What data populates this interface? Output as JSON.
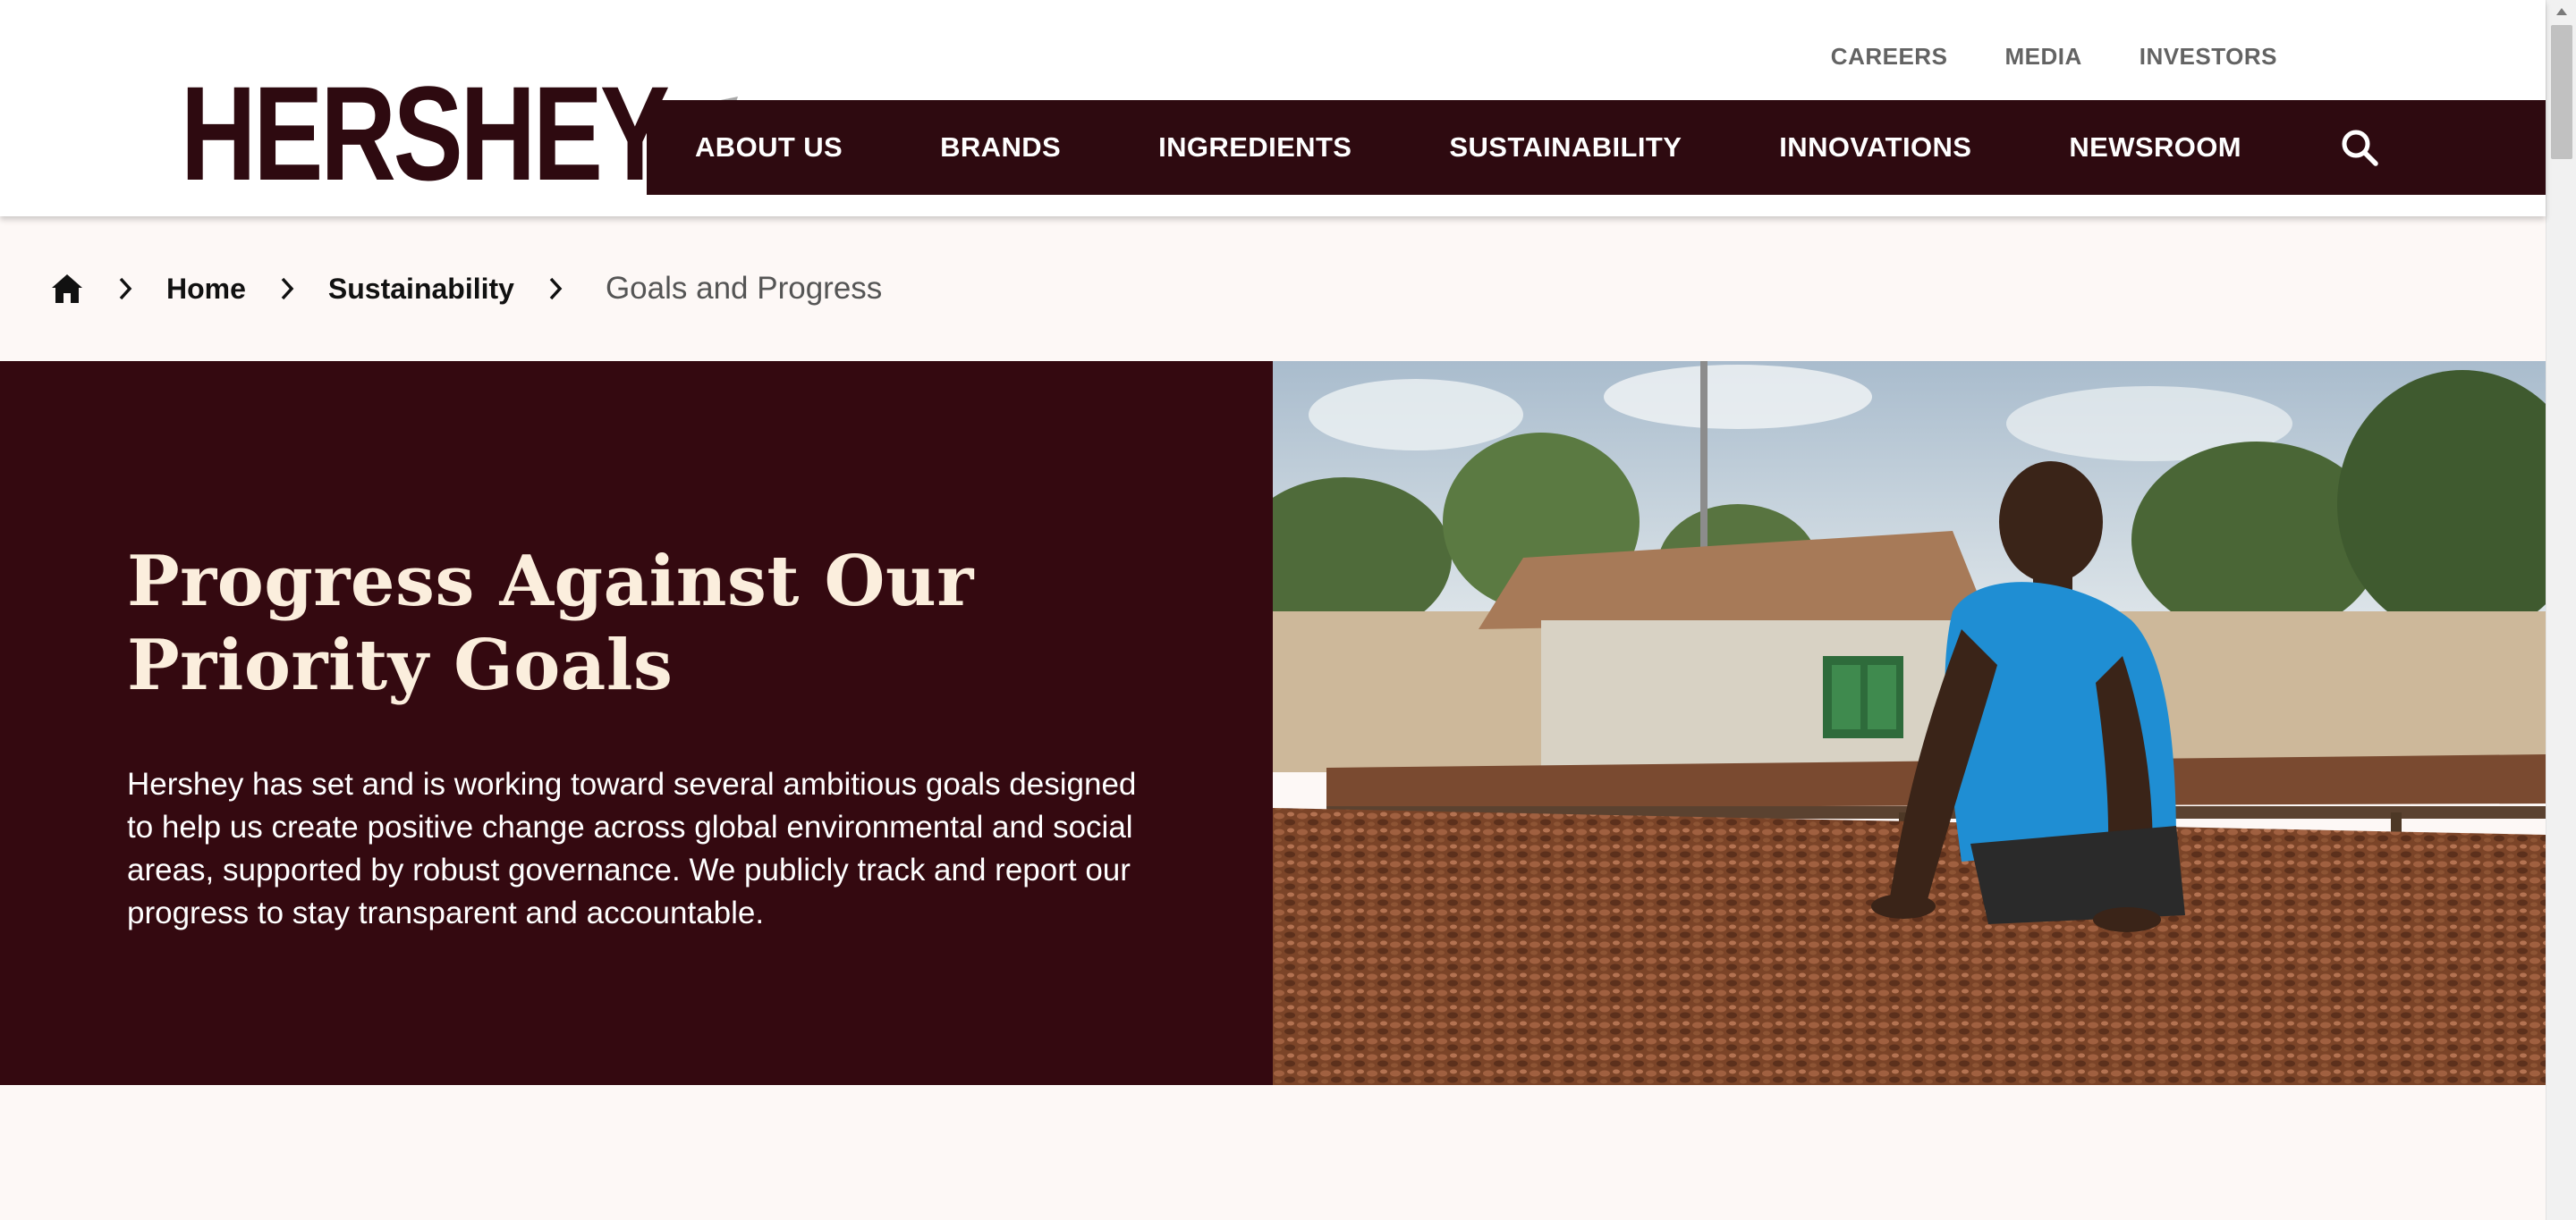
{
  "brand": {
    "logo_text": "HERSHEY",
    "primary_color": "#2e0a10",
    "hero_bg_color": "#340910",
    "title_color": "#fbeedd"
  },
  "utility_nav": {
    "items": [
      {
        "label": "CAREERS"
      },
      {
        "label": "MEDIA"
      },
      {
        "label": "INVESTORS"
      }
    ]
  },
  "main_nav": {
    "items": [
      {
        "label": "ABOUT US"
      },
      {
        "label": "BRANDS"
      },
      {
        "label": "INGREDIENTS"
      },
      {
        "label": "SUSTAINABILITY"
      },
      {
        "label": "INNOVATIONS"
      },
      {
        "label": "NEWSROOM"
      }
    ],
    "search_icon": "search-icon"
  },
  "breadcrumb": {
    "home_icon": "home-icon",
    "separator_icon": "chevron-right-icon",
    "items": [
      {
        "label": "Home"
      },
      {
        "label": "Sustainability"
      }
    ],
    "current": "Goals and Progress"
  },
  "hero": {
    "title_line1": "Progress Against Our",
    "title_line2": "Priority Goals",
    "body": "Hershey has set and is working toward several ambitious goals designed to help us create positive change across global environmental and social areas, supported by robust governance. We publicly track and report our progress to stay transparent and accountable."
  }
}
